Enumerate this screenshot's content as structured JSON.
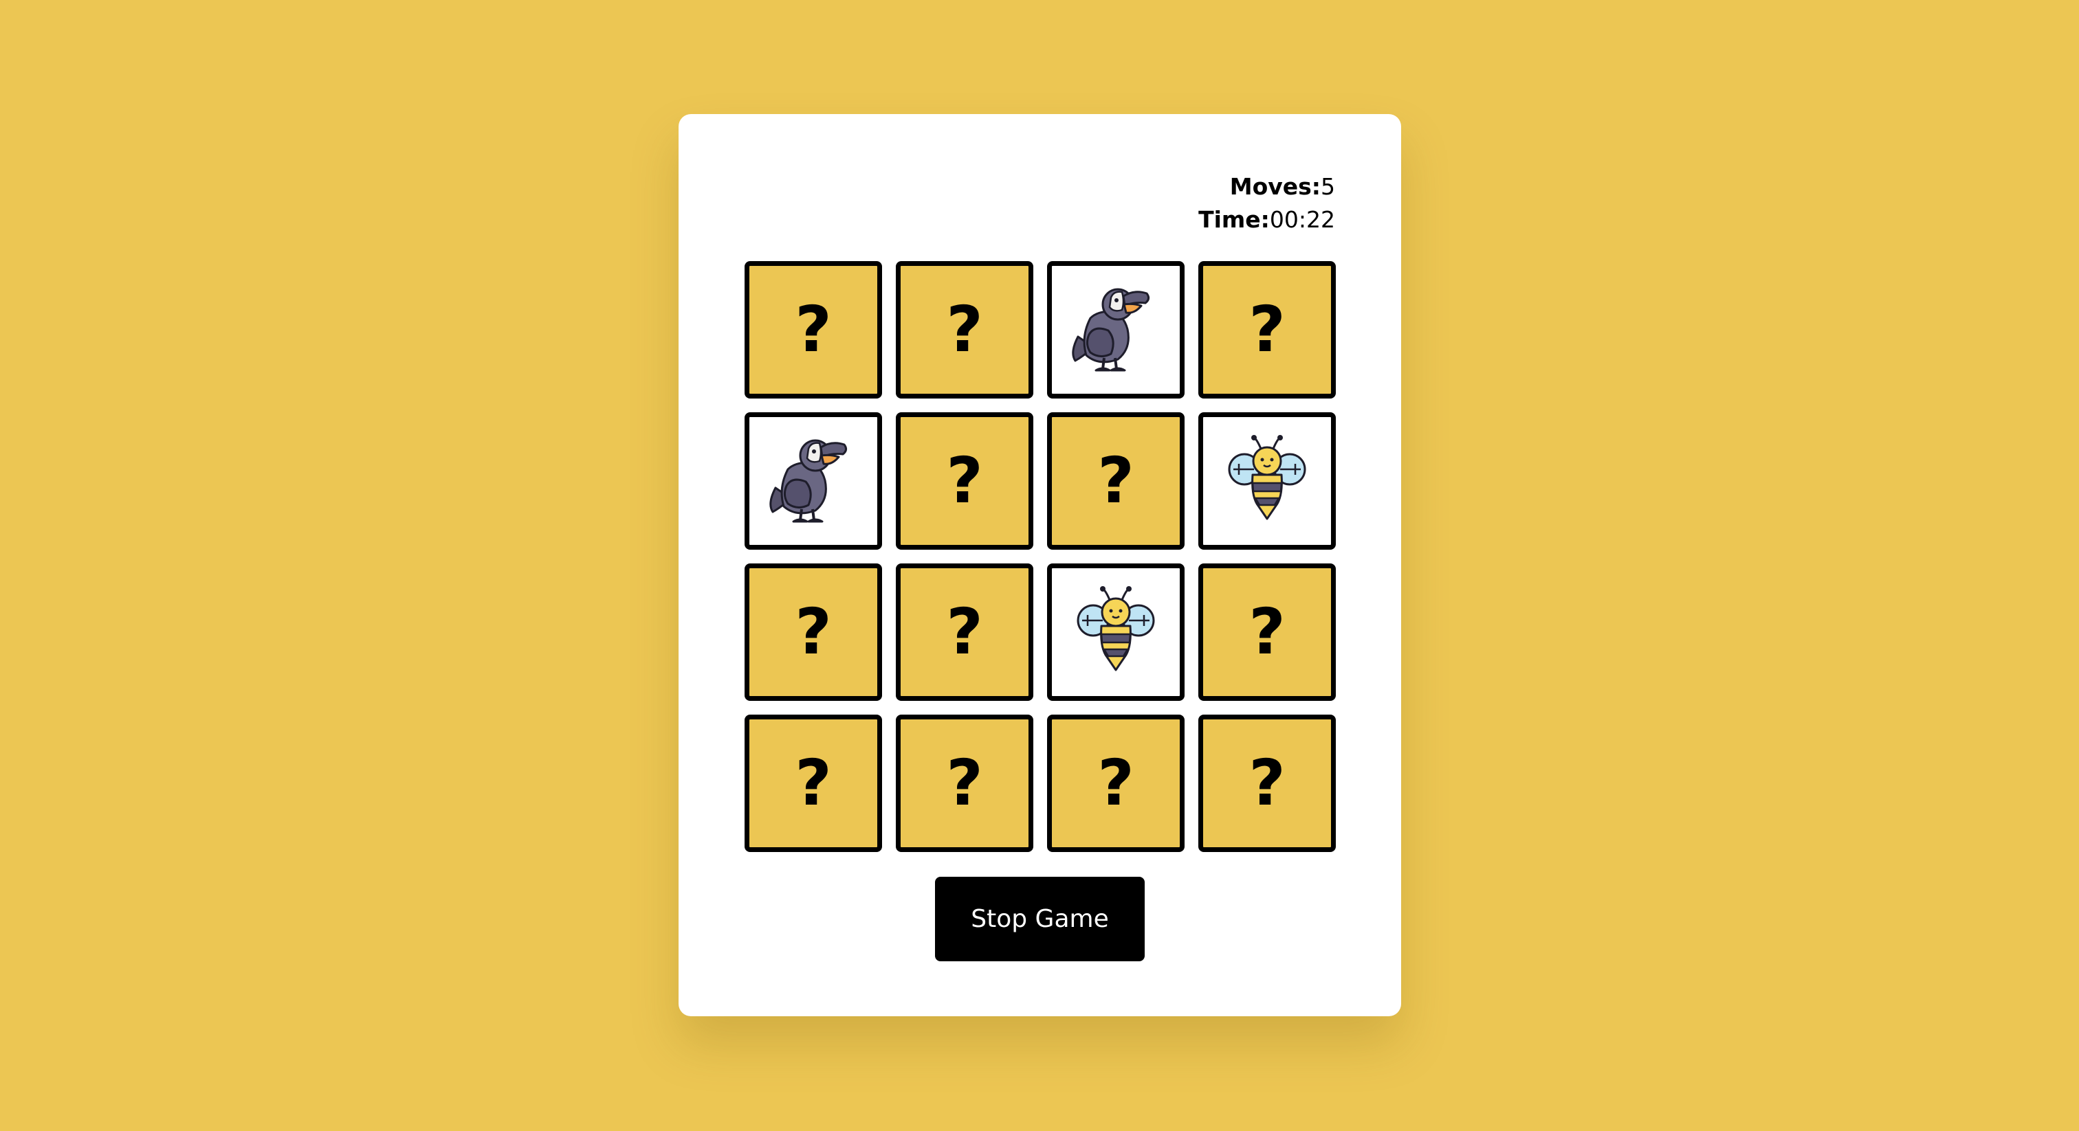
{
  "stats": {
    "moves_label": "Moves:",
    "moves_value": "5",
    "time_label": "Time:",
    "time_value": "00:22"
  },
  "cards": [
    {
      "state": "hidden",
      "face": "?"
    },
    {
      "state": "hidden",
      "face": "?"
    },
    {
      "state": "revealed",
      "icon": "toucan-icon"
    },
    {
      "state": "hidden",
      "face": "?"
    },
    {
      "state": "revealed",
      "icon": "toucan-icon"
    },
    {
      "state": "hidden",
      "face": "?"
    },
    {
      "state": "hidden",
      "face": "?"
    },
    {
      "state": "revealed",
      "icon": "bee-icon"
    },
    {
      "state": "hidden",
      "face": "?"
    },
    {
      "state": "hidden",
      "face": "?"
    },
    {
      "state": "revealed",
      "icon": "bee-icon"
    },
    {
      "state": "hidden",
      "face": "?"
    },
    {
      "state": "hidden",
      "face": "?"
    },
    {
      "state": "hidden",
      "face": "?"
    },
    {
      "state": "hidden",
      "face": "?"
    },
    {
      "state": "hidden",
      "face": "?"
    }
  ],
  "controls": {
    "stop_label": "Stop Game"
  },
  "colors": {
    "background": "#ECC653",
    "card_back": "#ECC653",
    "card_border": "#000000",
    "button": "#000000",
    "panel": "#FFFFFF"
  }
}
